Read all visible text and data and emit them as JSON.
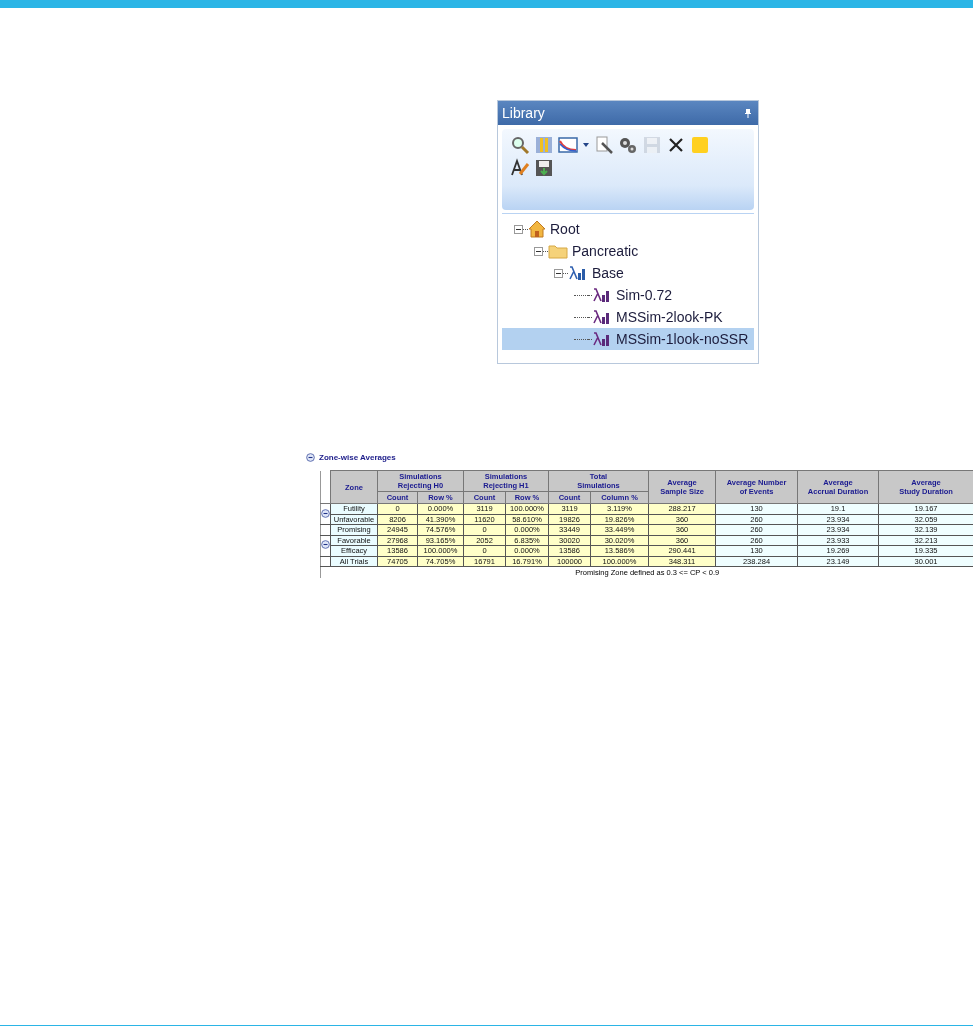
{
  "library": {
    "title": "Library",
    "toolbar": [
      {
        "disabled": false
      },
      {
        "disabled": false
      },
      {
        "disabled": false
      },
      {
        "disabled": false
      },
      {
        "disabled": false
      },
      {
        "disabled": false
      },
      {
        "disabled": true
      },
      {
        "disabled": false
      },
      {
        "disabled": false
      },
      {
        "disabled": false
      },
      {
        "disabled": false
      }
    ],
    "tree": [
      {
        "label": "Root",
        "kind": "home",
        "expanded": true,
        "selected": false,
        "children": [
          {
            "label": "Pancreatic",
            "kind": "folder",
            "expanded": true,
            "selected": false,
            "children": [
              {
                "label": "Base",
                "kind": "design",
                "expanded": true,
                "selected": false,
                "children": [
                  {
                    "label": "Sim-0.72",
                    "kind": "sim",
                    "selected": false
                  },
                  {
                    "label": "MSSim-2look-PK",
                    "kind": "sim",
                    "selected": false
                  },
                  {
                    "label": "MSSim-1look-noSSR",
                    "kind": "sim",
                    "selected": true
                  }
                ]
              }
            ]
          }
        ]
      }
    ]
  },
  "report": {
    "title": "Zone-wise Averages",
    "expanded": true,
    "table": {
      "header_groups": [
        {
          "label": "Zone",
          "kind": "single"
        },
        {
          "label": "Simulations\nRejecting H0",
          "kind": "pair"
        },
        {
          "label": "Simulations\nRejecting H1",
          "kind": "pair"
        },
        {
          "label": "Total\nSimulations",
          "kind": "pair"
        },
        {
          "label": "Average\nSample Size",
          "kind": "single"
        },
        {
          "label": "Average Number\nof Events",
          "kind": "single"
        },
        {
          "label": "Average\nAccrual Duration",
          "kind": "single"
        },
        {
          "label": "Average\nStudy Duration",
          "kind": "single"
        }
      ],
      "subheaders": [
        "Count",
        "Row %",
        "Count",
        "Row %",
        "Count",
        "Column %"
      ],
      "groups": [
        {
          "expanded": true,
          "rows": [
            [
              "Futility",
              "0",
              "0.000%",
              "3119",
              "100.000%",
              "3119",
              "3.119%",
              "288.217",
              "130",
              "19.1",
              "19.167"
            ],
            [
              "Unfavorable",
              "8206",
              "41.390%",
              "11620",
              "58.610%",
              "19826",
              "19.826%",
              "360",
              "260",
              "23.934",
              "32.059"
            ]
          ]
        },
        {
          "rows": [
            [
              "Promising",
              "24945",
              "74.576%",
              "0",
              "0.000%",
              "33449",
              "33.449%",
              "360",
              "260",
              "23.934",
              "32.139"
            ]
          ]
        },
        {
          "expanded": true,
          "rows": [
            [
              "Favorable",
              "27968",
              "93.165%",
              "2052",
              "6.835%",
              "30020",
              "30.020%",
              "360",
              "260",
              "23.933",
              "32.213"
            ],
            [
              "Efficacy",
              "13586",
              "100.000%",
              "0",
              "0.000%",
              "13586",
              "13.586%",
              "290.441",
              "130",
              "19.269",
              "19.335"
            ]
          ]
        },
        {
          "rows": [
            [
              "All Trials",
              "74705",
              "74.705%",
              "16791",
              "16.791%",
              "100000",
              "100.000%",
              "348.311",
              "238.284",
              "23.149",
              "30.001"
            ]
          ]
        }
      ],
      "footnote": "Promising Zone defined as 0.3 <= CP < 0.9"
    }
  }
}
